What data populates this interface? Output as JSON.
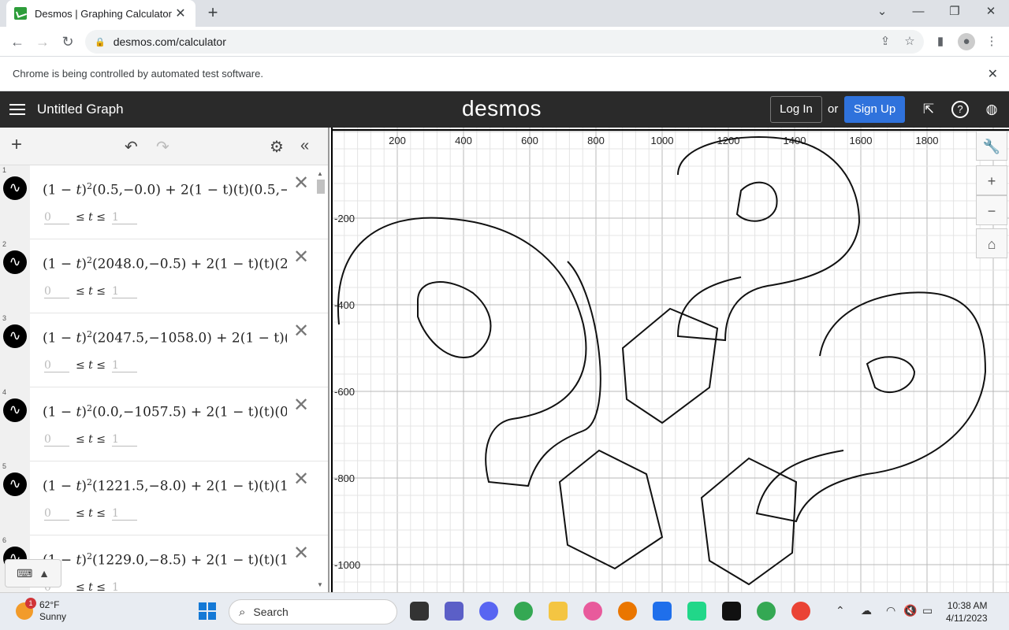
{
  "browser": {
    "tab_title": "Desmos | Graphing Calculator",
    "url": "desmos.com/calculator",
    "infobar_text": "Chrome is being controlled by automated test software."
  },
  "desmos": {
    "graph_title": "Untitled Graph",
    "logo": "desmos",
    "login_label": "Log In",
    "or_label": "or",
    "signup_label": "Sign Up"
  },
  "expressions": [
    {
      "num": "1",
      "p0": "(0.5,−0.0)",
      "tail": "+ 2(1 − t)(t)(0.5,−",
      "lower": "0",
      "upper": "1"
    },
    {
      "num": "2",
      "p0": "(2048.0,−0.5)",
      "tail": "+ 2(1 − t)(t)(2",
      "lower": "0",
      "upper": "1"
    },
    {
      "num": "3",
      "p0": "(2047.5,−1058.0)",
      "tail": "+ 2(1 − t)(",
      "lower": "0",
      "upper": "1"
    },
    {
      "num": "4",
      "p0": "(0.0,−1057.5)",
      "tail": "+ 2(1 − t)(t)(0",
      "lower": "0",
      "upper": "1"
    },
    {
      "num": "5",
      "p0": "(1221.5,−8.0)",
      "tail": "+ 2(1 − t)(t)(1",
      "lower": "0",
      "upper": "1"
    },
    {
      "num": "6",
      "p0": "(1229.0,−8.5)",
      "tail": "+ 2(1 − t)(t)(1",
      "lower": "0",
      "upper": "1"
    }
  ],
  "graph": {
    "x_ticks": [
      "200",
      "400",
      "600",
      "800",
      "1000",
      "1200",
      "1400",
      "1600",
      "1800"
    ],
    "y_ticks": [
      "-200",
      "-400",
      "-600",
      "-800",
      "-1000"
    ]
  },
  "taskbar": {
    "weather_temp": "62°F",
    "weather_cond": "Sunny",
    "weather_badge": "1",
    "search_label": "Search",
    "time": "10:38 AM",
    "date": "4/11/2023"
  }
}
